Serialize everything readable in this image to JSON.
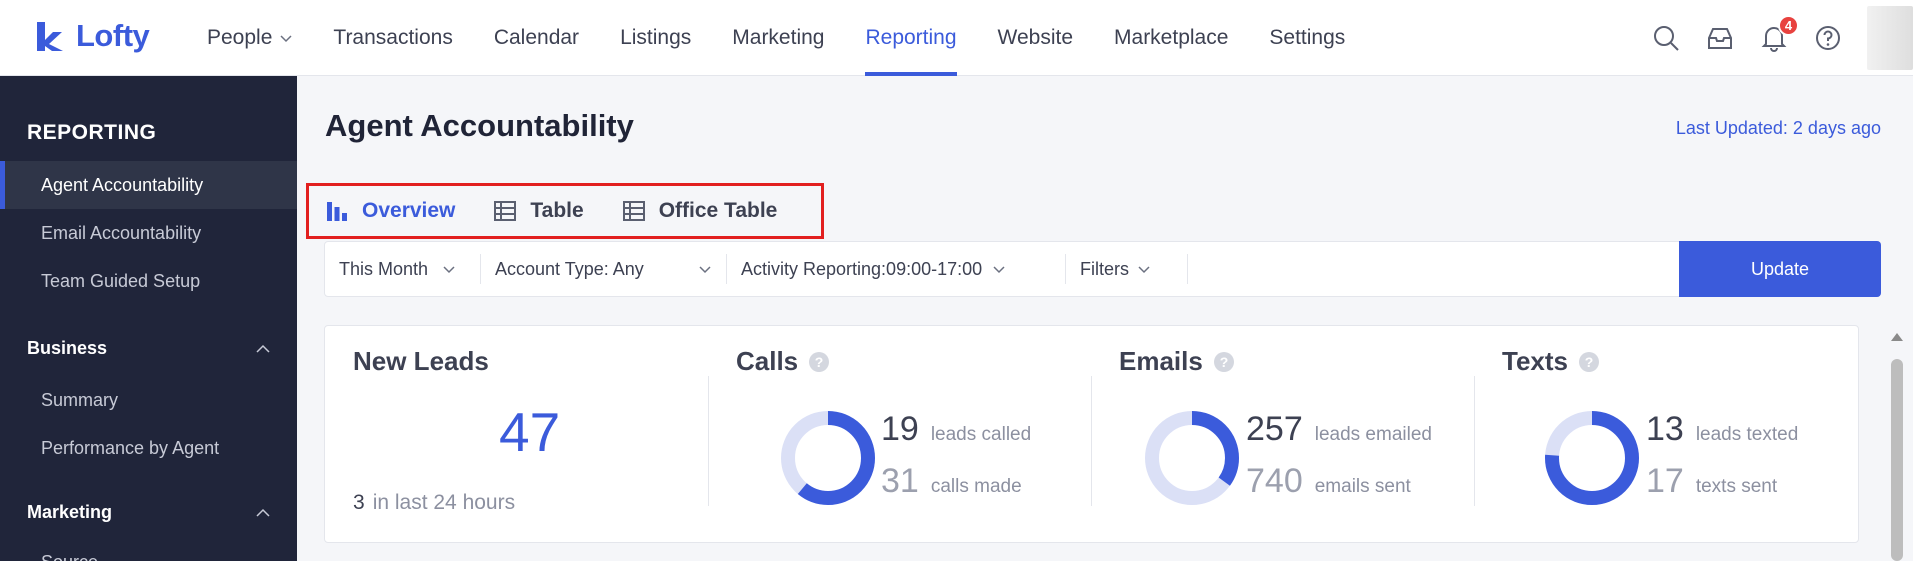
{
  "brand": {
    "name": "Lofty",
    "color": "#3b5bdb"
  },
  "nav": {
    "items": [
      {
        "label": "People",
        "has_dropdown": true
      },
      {
        "label": "Transactions"
      },
      {
        "label": "Calendar"
      },
      {
        "label": "Listings"
      },
      {
        "label": "Marketing"
      },
      {
        "label": "Reporting",
        "active": true
      },
      {
        "label": "Website"
      },
      {
        "label": "Marketplace"
      },
      {
        "label": "Settings"
      }
    ],
    "icons": [
      "search-icon",
      "inbox-icon",
      "bell-icon",
      "help-icon"
    ],
    "notification_count": "4"
  },
  "sidebar": {
    "title": "REPORTING",
    "items": [
      {
        "label": "Agent Accountability",
        "active": true
      },
      {
        "label": "Email Accountability"
      },
      {
        "label": "Team Guided Setup"
      }
    ],
    "sections": [
      {
        "label": "Business",
        "items": [
          "Summary",
          "Performance by Agent"
        ]
      },
      {
        "label": "Marketing",
        "items": [
          "Source"
        ]
      }
    ]
  },
  "page": {
    "title": "Agent Accountability",
    "last_updated": "Last Updated: 2 days ago"
  },
  "tabs": [
    {
      "label": "Overview",
      "icon": "bar-chart-icon",
      "active": true
    },
    {
      "label": "Table",
      "icon": "table-icon"
    },
    {
      "label": "Office Table",
      "icon": "table-icon"
    }
  ],
  "filters": {
    "items": [
      "This Month",
      "Account Type: Any",
      "Activity Reporting:09:00-17:00",
      "Filters"
    ],
    "update_label": "Update"
  },
  "stats": {
    "new_leads": {
      "title": "New Leads",
      "value": "47",
      "recent_count": "3",
      "recent_label": "in last 24 hours"
    },
    "calls": {
      "title": "Calls",
      "primary_value": "19",
      "primary_label": "leads called",
      "secondary_value": "31",
      "secondary_label": "calls made",
      "ratio": 0.61
    },
    "emails": {
      "title": "Emails",
      "primary_value": "257",
      "primary_label": "leads emailed",
      "secondary_value": "740",
      "secondary_label": "emails sent",
      "ratio": 0.35
    },
    "texts": {
      "title": "Texts",
      "primary_value": "13",
      "primary_label": "leads texted",
      "secondary_value": "17",
      "secondary_label": "texts sent",
      "ratio": 0.76
    }
  },
  "colors": {
    "accent": "#3b5bdb",
    "donut_track": "#dbe0f6",
    "highlight_box": "#e21f1f",
    "sidebar_bg": "#20253a"
  }
}
